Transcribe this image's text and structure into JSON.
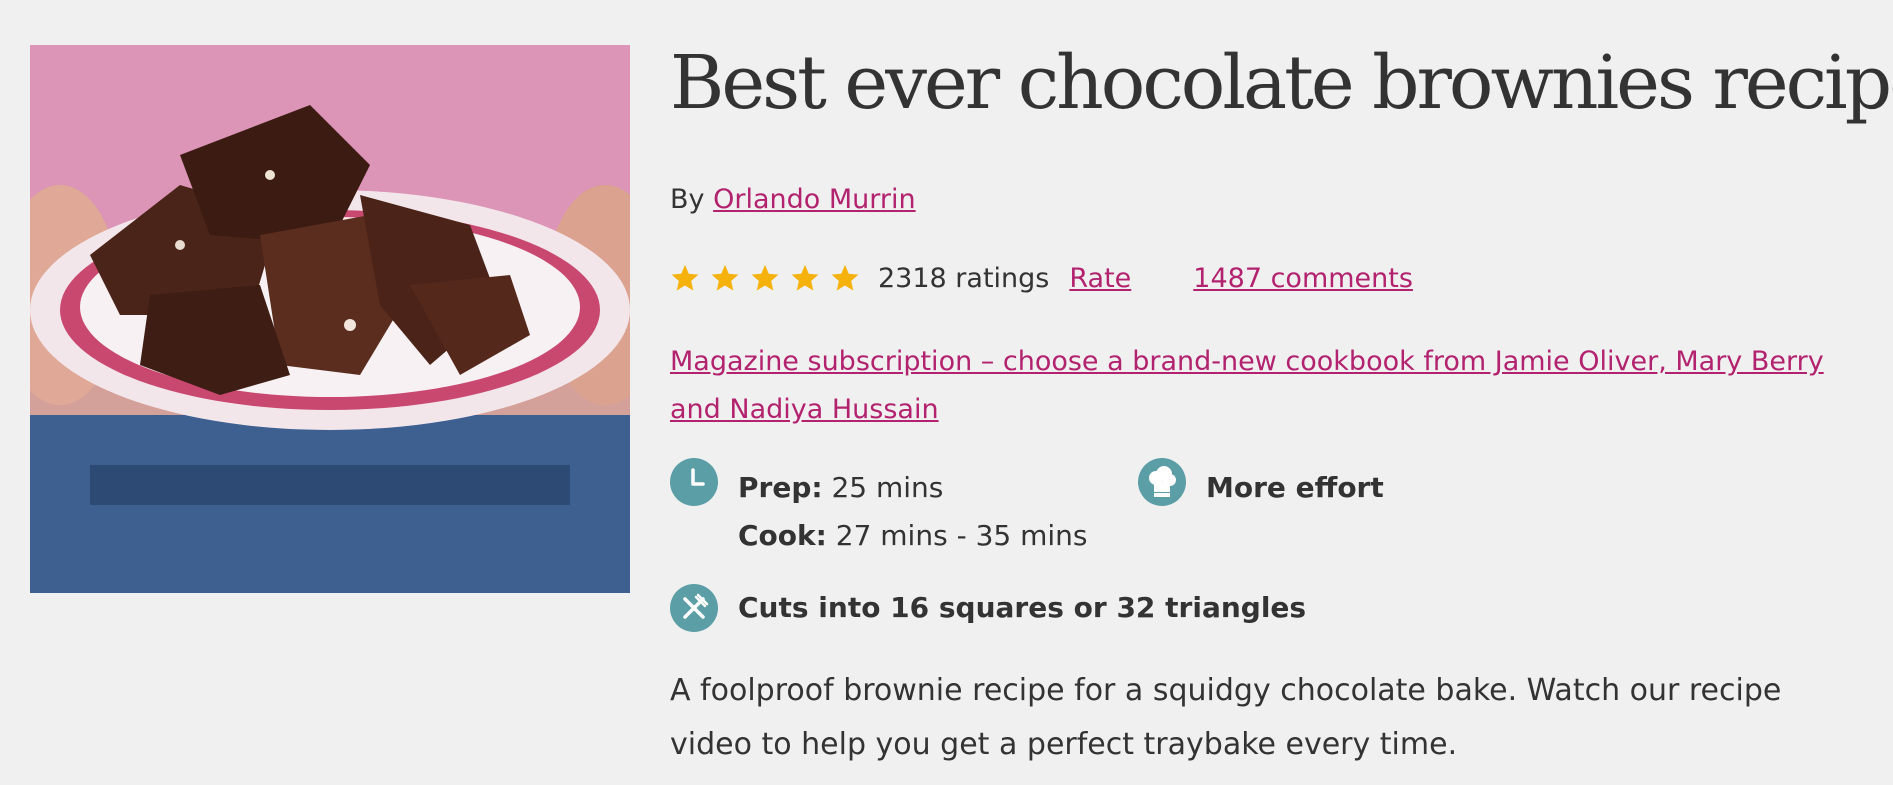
{
  "hero_image": {
    "alt": "Best ever chocolate brownies"
  },
  "recipe": {
    "title": "Best ever chocolate brownies recipe",
    "byline_prefix": "By",
    "author": "Orlando Murrin",
    "rating": {
      "stars": 5,
      "count_text": "2318 ratings",
      "rate_label": "Rate"
    },
    "comments_label": "1487 comments",
    "promo_text": "Magazine subscription – choose a brand-new cookbook from Jamie Oliver, Mary Berry and Nadiya Hussain",
    "prep_label": "Prep:",
    "prep_value": "25 mins",
    "cook_label": "Cook:",
    "cook_value": "27 mins - 35 mins",
    "effort": "More effort",
    "serves": "Cuts into 16 squares or 32 triangles",
    "description": "A foolproof brownie recipe for a squidgy chocolate bake. Watch our recipe video to help you get a perfect traybake every time."
  },
  "icons": {
    "time": "clock-icon",
    "effort": "chef-hat-icon",
    "serves": "cutlery-icon",
    "star": "star-icon"
  },
  "colors": {
    "accent": "#b2226e",
    "icon_bg": "#5b9ea6",
    "star": "#f5b20a",
    "text": "#333333",
    "background": "#f0f0f0"
  }
}
